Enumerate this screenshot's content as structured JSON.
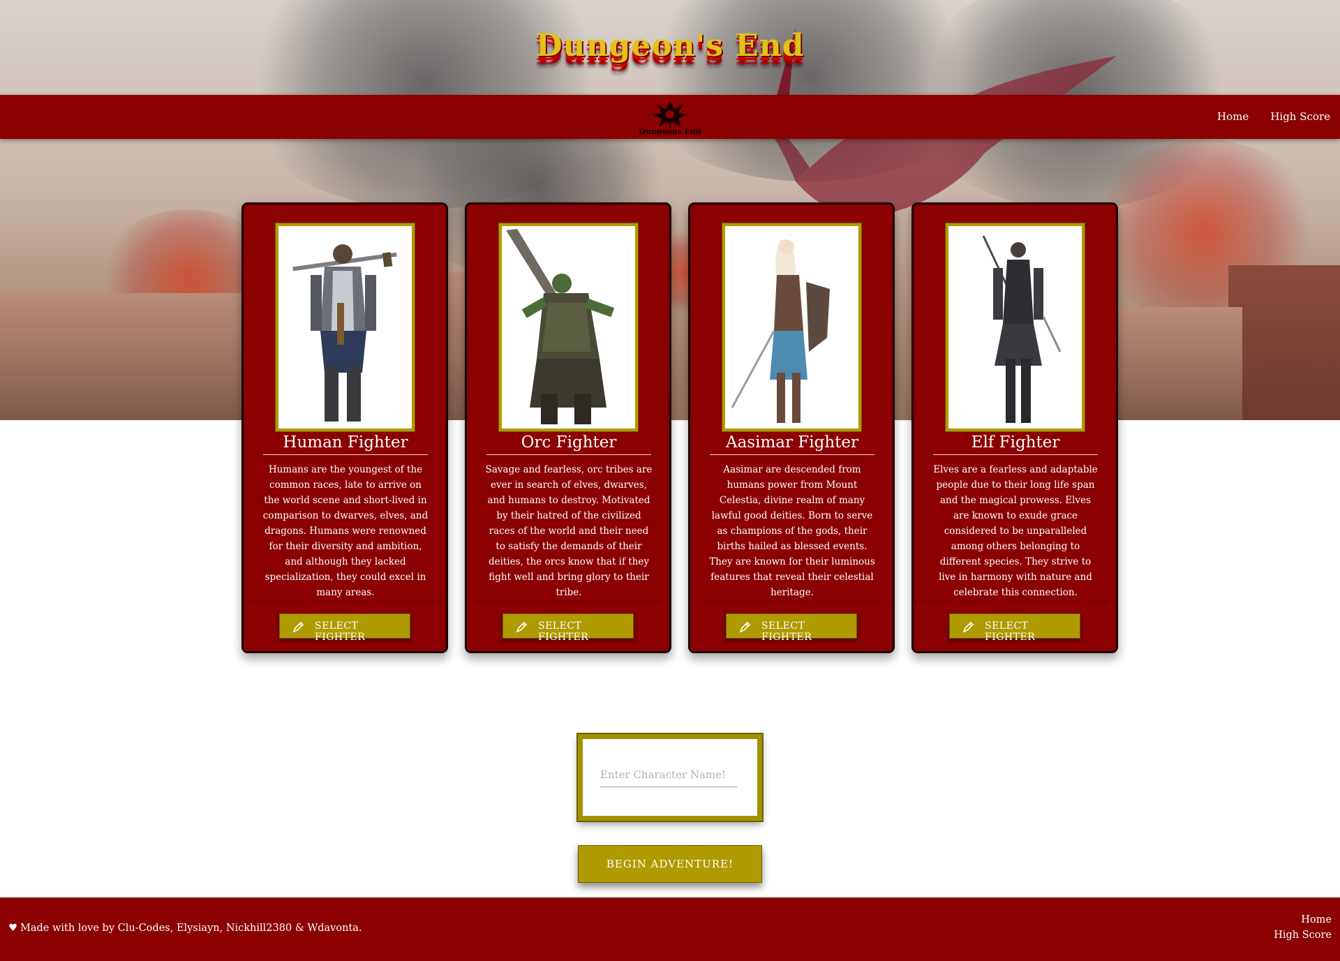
{
  "site": {
    "title": "Dungeon's End",
    "logo_text": "Dungeons End"
  },
  "nav": {
    "links": [
      {
        "label": "Home"
      },
      {
        "label": "High Score"
      }
    ]
  },
  "fighters": [
    {
      "name": "Human Fighter",
      "description": "Humans are the youngest of the common races, late to arrive on the world scene and short-lived in comparison to dwarves, elves, and dragons. Humans were renowned for their diversity and ambition, and although they lacked specialization, they could excel in many areas.",
      "button_label": "SELECT FIGHTER"
    },
    {
      "name": "Orc Fighter",
      "description": "Savage and fearless, orc tribes are ever in search of elves, dwarves, and humans to destroy. Motivated by their hatred of the civilized races of the world and their need to satisfy the demands of their deities, the orcs know that if they fight well and bring glory to their tribe.",
      "button_label": "SELECT FIGHTER"
    },
    {
      "name": "Aasimar Fighter",
      "description": "Aasimar are descended from humans power from Mount Celestia, divine realm of many lawful good deities. Born to serve as champions of the gods, their births hailed as blessed events. They are known for their luminous features that reveal their celestial heritage.",
      "button_label": "SELECT FIGHTER"
    },
    {
      "name": "Elf Fighter",
      "description": "Elves are a fearless and adaptable people due to their long life span and the magical prowess. Elves are known to exude grace considered to be unparalleled among others belonging to different species. They strive to live in harmony with nature and celebrate this connection.",
      "button_label": "SELECT FIGHTER"
    }
  ],
  "character_name": {
    "placeholder": "Enter Character Name!",
    "value": ""
  },
  "begin_button": "BEGIN ADVENTURE!",
  "footer": {
    "credit": "Made with love by Clu-Codes, Elysiayn, Nickhill2380 & Wdavonta.",
    "links": [
      {
        "label": "Home"
      },
      {
        "label": "High Score"
      }
    ]
  },
  "colors": {
    "primary_red": "#8b0000",
    "gold": "#b09a02",
    "title_gold": "#e1c21a"
  }
}
